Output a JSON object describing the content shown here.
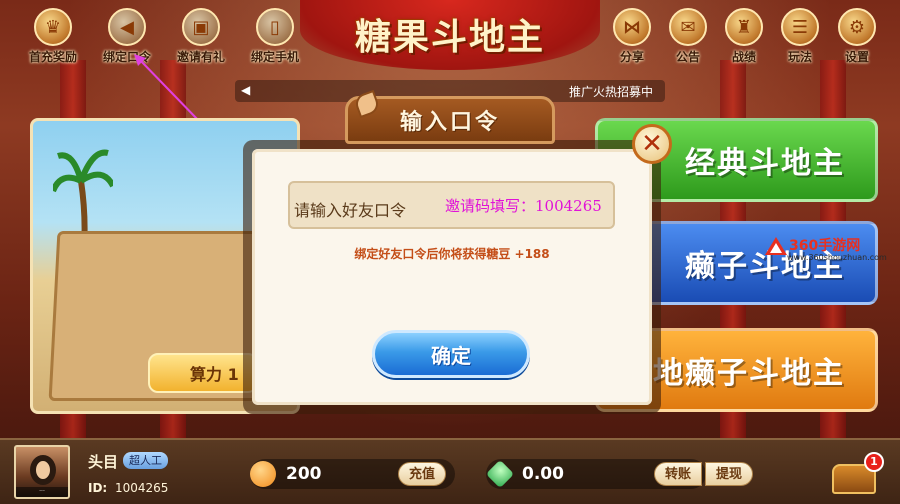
{
  "game_title": "糖果斗地主",
  "top_left_buttons": [
    {
      "label": "首充奖励",
      "icon": "gift-box-icon"
    },
    {
      "label": "绑定口令",
      "icon": "megaphone-icon"
    },
    {
      "label": "邀请有礼",
      "icon": "present-icon"
    },
    {
      "label": "绑定手机",
      "icon": "phone-icon"
    }
  ],
  "top_right_buttons": [
    {
      "label": "分享",
      "icon": "share-icon"
    },
    {
      "label": "公告",
      "icon": "mail-icon"
    },
    {
      "label": "战绩",
      "icon": "record-icon"
    },
    {
      "label": "玩法",
      "icon": "rules-icon"
    },
    {
      "label": "设置",
      "icon": "gear-icon"
    }
  ],
  "notice": {
    "text": "推广火热招募中"
  },
  "left_panel": {
    "button_label": "算力 1"
  },
  "modes": [
    {
      "label": "经典斗地主",
      "color": "#3ea82a"
    },
    {
      "label": "癞子斗地主",
      "color": "#2a62d0"
    },
    {
      "label": "地癞子斗地主",
      "color": "#f0901e"
    }
  ],
  "watermark": {
    "title": "360手游网",
    "url": "www.360shouzhuan.com"
  },
  "dialog": {
    "title": "输入口令",
    "input_placeholder": "请输入好友口令",
    "overlay_text": "邀请码填写：1004265",
    "hint": "绑定好友口令后你将获得糖豆 +188",
    "confirm_label": "确定"
  },
  "user": {
    "name": "头目",
    "tag": "超人工",
    "id_label": "ID:",
    "id": "1004265"
  },
  "resources": {
    "candy": {
      "value": "200",
      "button": "充值"
    },
    "gem": {
      "value": "0.00",
      "transfer": "转账",
      "withdraw": "提现"
    }
  },
  "chest_badge": "1",
  "colors": {
    "dialog_bg": "#fbf6ec",
    "confirm_blue": "#2a86e0",
    "hint_orange": "#c44e18",
    "overlay_magenta": "#e012d8"
  }
}
